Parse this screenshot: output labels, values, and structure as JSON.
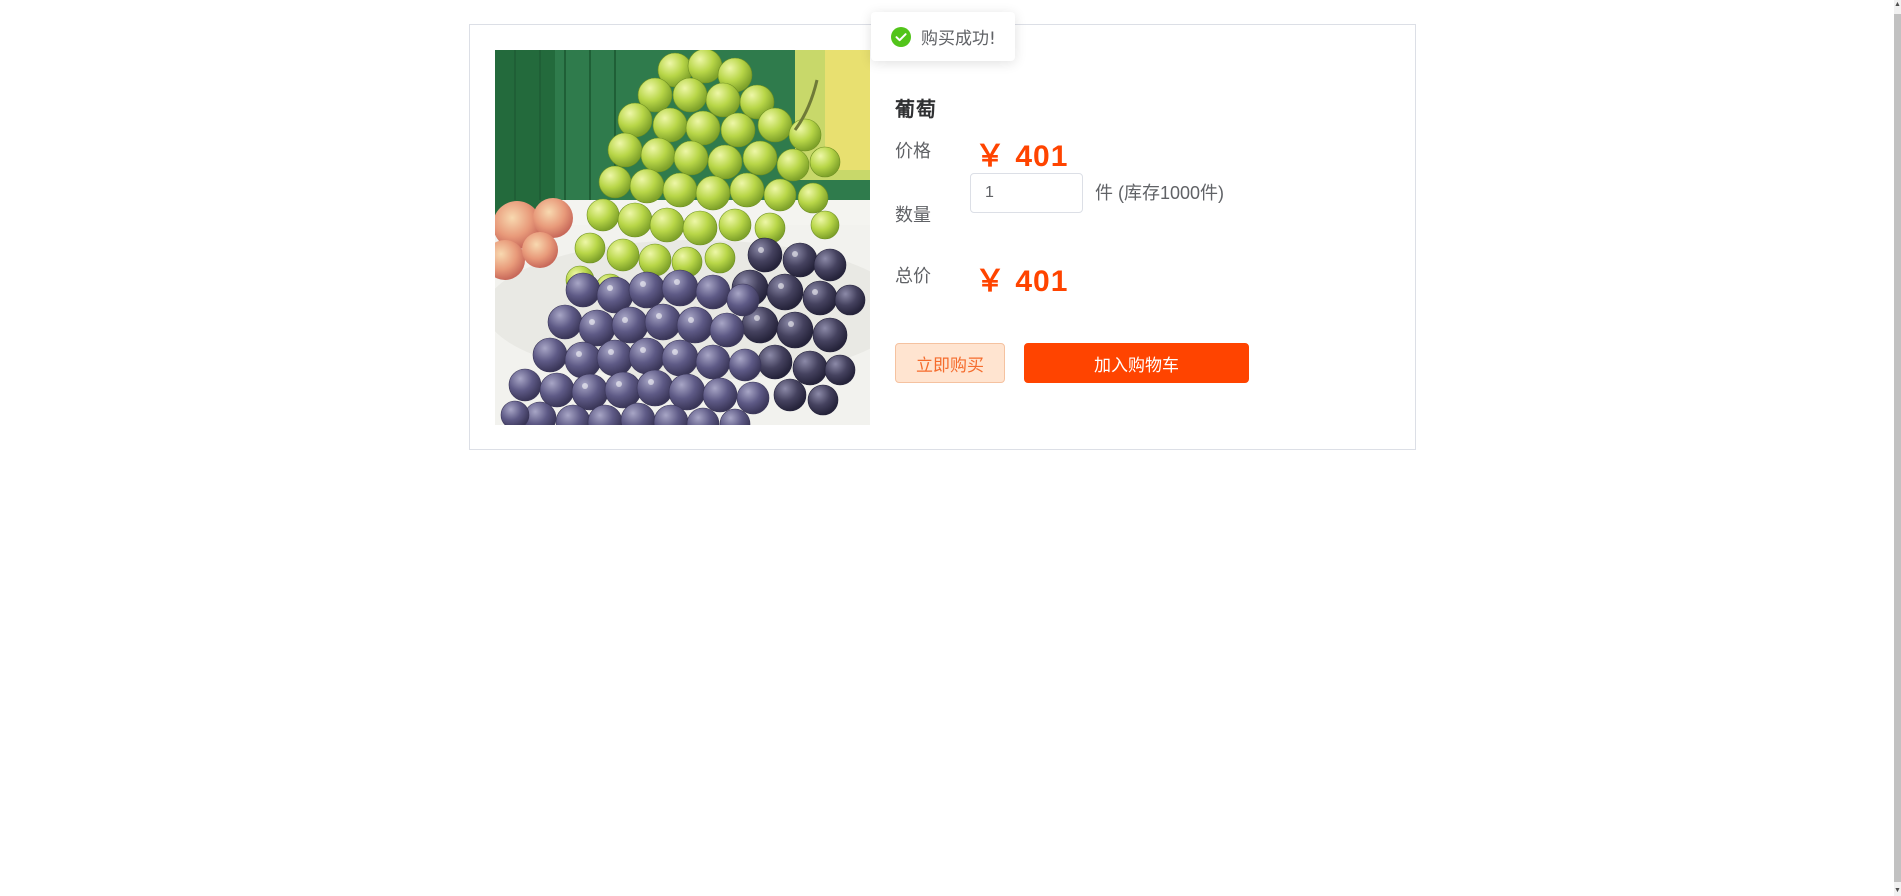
{
  "toast": {
    "icon": "success-check-icon",
    "message": "购买成功!",
    "icon_color": "#52c41a"
  },
  "product": {
    "name": "葡萄",
    "image": "grapes-photo",
    "price_label": "价格",
    "price_value": "￥ 401",
    "quantity_label": "数量",
    "quantity_value": "1",
    "stock_text": "件 (库存1000件)",
    "total_label": "总价",
    "total_value": "￥ 401"
  },
  "actions": {
    "buy_now_label": "立即购买",
    "add_to_cart_label": "加入购物车"
  },
  "colors": {
    "price": "#ff4400",
    "primary_button": "#ff4400",
    "secondary_button_bg": "#ffe4d0"
  }
}
